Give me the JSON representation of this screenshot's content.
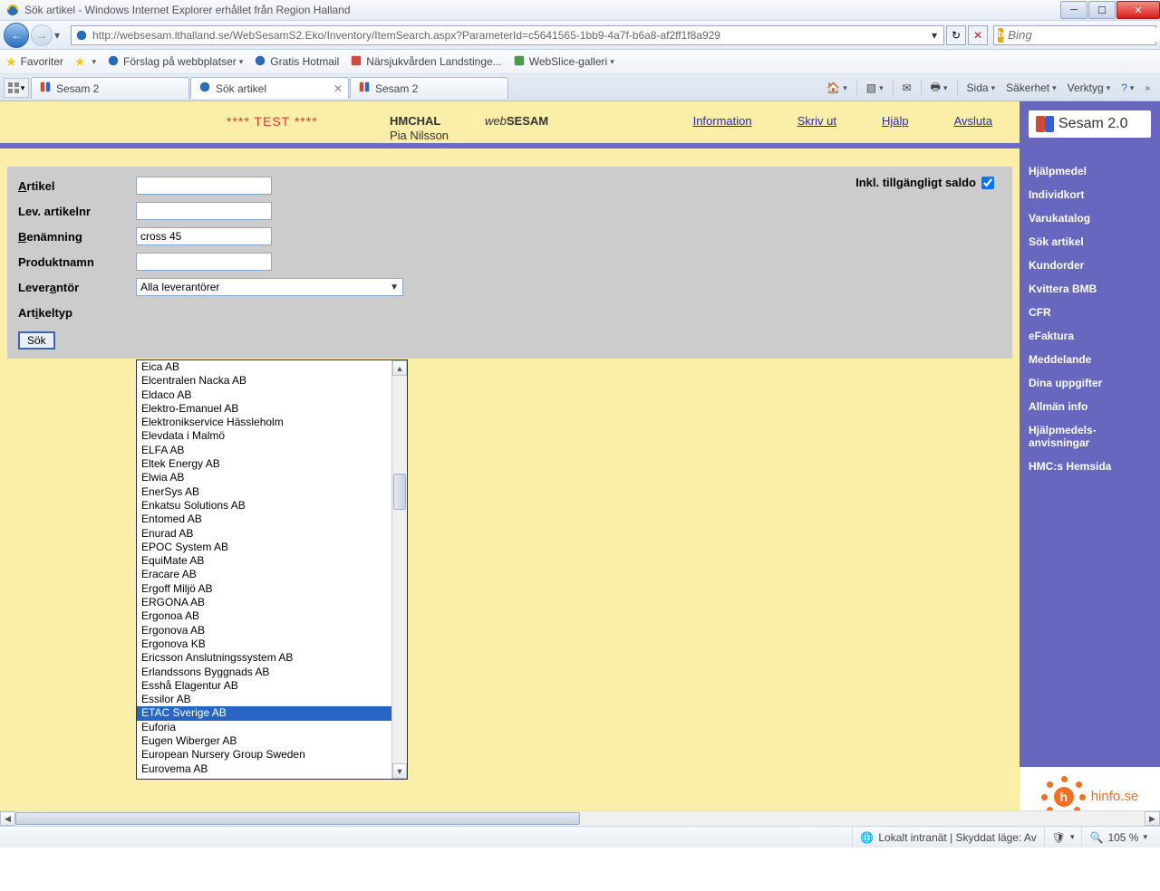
{
  "window": {
    "title": "Sök artikel - Windows Internet Explorer erhållet från Region Halland"
  },
  "nav": {
    "url": "http://websesam.lthalland.se/WebSesamS2.Eko/Inventory/ItemSearch.aspx?ParameterId=c5641565-1bb9-4a7f-b6a8-af2ff1f8a929",
    "search_placeholder": "Bing"
  },
  "favorites": {
    "label": "Favoriter",
    "items": [
      "Förslag på webbplatser",
      "Gratis Hotmail",
      "Närsjukvården Landstinge...",
      "WebSlice-galleri"
    ]
  },
  "tabs": [
    {
      "label": "Sesam 2",
      "active": false
    },
    {
      "label": "Sök artikel",
      "active": true
    },
    {
      "label": "Sesam 2",
      "active": false
    }
  ],
  "commands": {
    "sida": "Sida",
    "sakerhet": "Säkerhet",
    "verktyg": "Verktyg"
  },
  "header": {
    "test": "**** TEST ****",
    "user_code": "HMCHAL",
    "user_name": "Pia Nilsson",
    "brand_italic": "web",
    "brand_bold": "SESAM",
    "links": {
      "information": "Information",
      "skriv_ut": "Skriv ut",
      "hjalp": "Hjälp",
      "avsluta": "Avsluta"
    }
  },
  "form": {
    "artikel_label": "Artikel",
    "levartnr_label": "Lev. artikelnr",
    "benamning_label": "Benämning",
    "benamning_value": "cross 45",
    "produktnamn_label": "Produktnamn",
    "leverantor_label": "Leverantör",
    "leverantor_value": "Alla leverantörer",
    "artikeltyp_label": "Artikeltyp",
    "saldo_label": "Inkl. tillgängligt saldo",
    "sok_button": "Sök"
  },
  "dropdown": {
    "items": [
      "Eica AB",
      "Elcentralen Nacka AB",
      "Eldaco AB",
      "Elektro-Emanuel AB",
      "Elektronikservice Hässleholm",
      "Elevdata i Malmö",
      "ELFA AB",
      "Eltek Energy AB",
      "Elwia AB",
      "EnerSys AB",
      "Enkatsu Solutions AB",
      "Entomed AB",
      "Enurad AB",
      "EPOC System AB",
      "EquiMate AB",
      "Eracare AB",
      "Ergoff Miljö AB",
      "ERGONA AB",
      "Ergonoa AB",
      "Ergonova AB",
      "Ergonova KB",
      "Ericsson Anslutningssystem AB",
      "Erlandssons Byggnads AB",
      "Esshå Elagentur AB",
      "Essilor AB",
      "ETAC Sverige AB",
      "Euforia",
      "Eugen Wiberger AB",
      "European Nursery Group Sweden",
      "Eurovema AB"
    ],
    "selected_index": 25
  },
  "sidebar": {
    "logo": "Sesam 2.0",
    "links": [
      "Hjälpmedel",
      "Individkort",
      "Varukatalog",
      "Sök artikel",
      "Kundorder",
      "Kvittera BMB",
      "CFR",
      "eFaktura",
      "Meddelande",
      "Dina uppgifter",
      "Allmän info",
      "Hjälpmedels-anvisningar",
      "HMC:s Hemsida"
    ],
    "hinfo": "hinfo.se"
  },
  "status": {
    "text": "Lokalt intranät | Skyddat läge: Av",
    "zoom": "105 %"
  }
}
